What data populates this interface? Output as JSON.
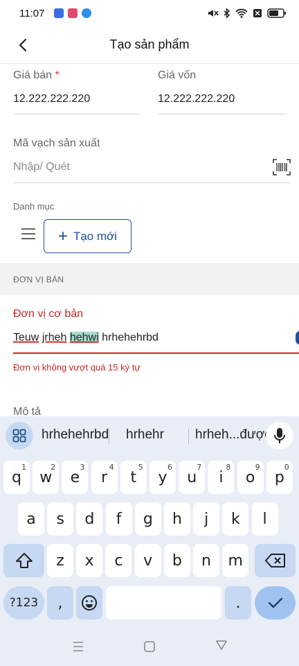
{
  "status_bar": {
    "time": "11:07"
  },
  "header": {
    "title": "Tạo sản phẩm"
  },
  "form": {
    "sale_price": {
      "label": "Giá bán",
      "required_mark": "*",
      "value": "12.222.222.220"
    },
    "cost_price": {
      "label": "Giá vốn",
      "value": "12.222.222.220"
    },
    "barcode": {
      "label": "Mã vạch sản xuất",
      "placeholder": "Nhập/ Quét"
    },
    "category": {
      "label": "Danh mục",
      "create_label": "Tạo mới"
    },
    "section_unit": "ĐƠN VỊ BÁN",
    "base_unit": {
      "label": "Đơn vị cơ bản",
      "words": [
        "Teuw",
        "jrheh",
        "hehwi",
        "hrhehehrbd"
      ],
      "error": "Đơn vị không vượt quá 15 ký tự"
    },
    "description": {
      "label": "Mô tả"
    }
  },
  "keyboard": {
    "suggestions": [
      "hrhehehrbd",
      "hrhehr",
      "hrheh...được"
    ],
    "row1": [
      {
        "k": "q",
        "h": "1"
      },
      {
        "k": "w",
        "h": "2"
      },
      {
        "k": "e",
        "h": "3"
      },
      {
        "k": "r",
        "h": "4"
      },
      {
        "k": "t",
        "h": "5"
      },
      {
        "k": "y",
        "h": "6"
      },
      {
        "k": "u",
        "h": "7"
      },
      {
        "k": "i",
        "h": "8"
      },
      {
        "k": "o",
        "h": "9"
      },
      {
        "k": "p",
        "h": "0"
      }
    ],
    "row2": [
      "a",
      "s",
      "d",
      "f",
      "g",
      "h",
      "j",
      "k",
      "l"
    ],
    "row3": [
      "z",
      "x",
      "c",
      "v",
      "b",
      "n",
      "m"
    ],
    "symbols_label": "?123",
    "comma": ",",
    "period": "."
  }
}
